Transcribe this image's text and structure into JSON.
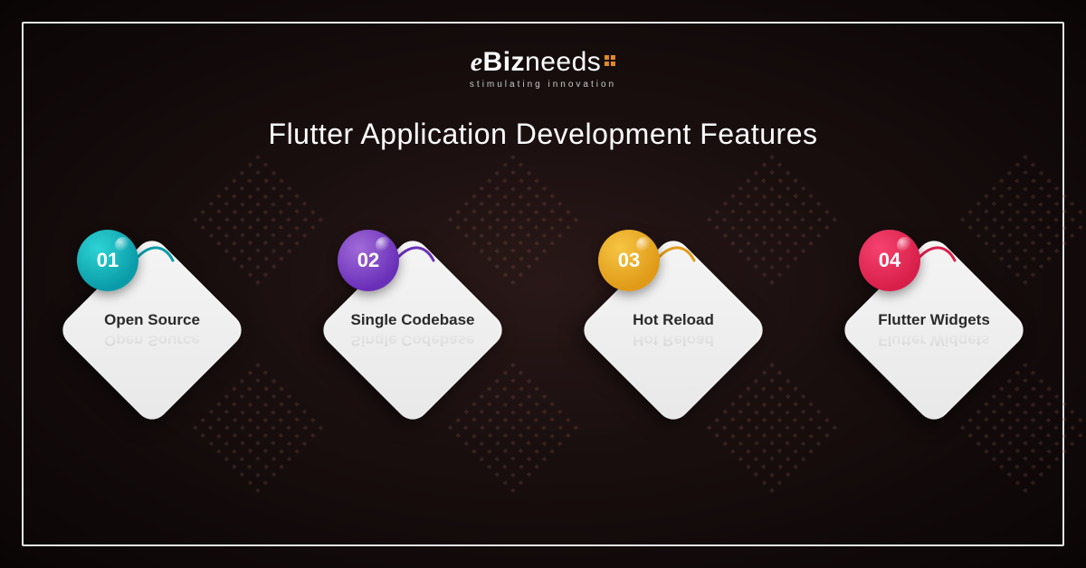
{
  "logo": {
    "brand_e": "e",
    "brand_biz": "Biz",
    "brand_needs": "needs",
    "tagline": "stimulating innovation"
  },
  "title": "Flutter Application Development Features",
  "features": [
    {
      "num": "01",
      "label": "Open Source",
      "color": "#0a9ba8"
    },
    {
      "num": "02",
      "label": "Single Codebase",
      "color": "#6a2fb8"
    },
    {
      "num": "03",
      "label": "Hot Reload",
      "color": "#e09a18"
    },
    {
      "num": "04",
      "label": "Flutter Widgets",
      "color": "#d81f4a"
    }
  ]
}
